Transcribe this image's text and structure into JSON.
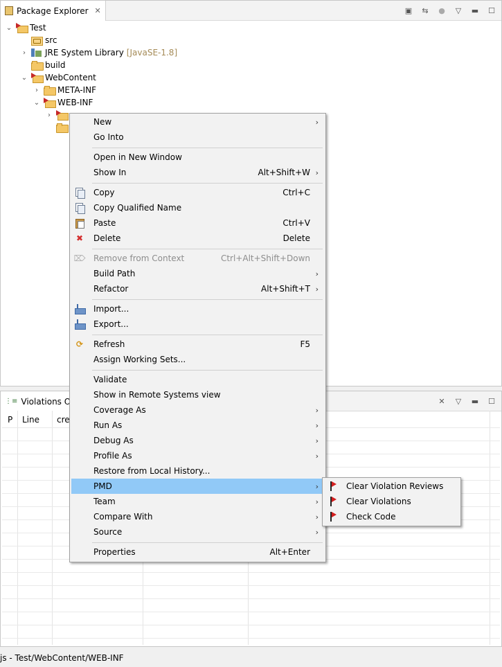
{
  "package_explorer": {
    "tab_title": "Package Explorer",
    "tree": [
      {
        "label": "Test",
        "decoration": ""
      },
      {
        "label": "src",
        "decoration": ""
      },
      {
        "label": "JRE System Library",
        "decoration": "[JavaSE-1.8]"
      },
      {
        "label": "build",
        "decoration": ""
      },
      {
        "label": "WebContent",
        "decoration": ""
      },
      {
        "label": "META-INF",
        "decoration": ""
      },
      {
        "label": "WEB-INF",
        "decoration": ""
      }
    ]
  },
  "violations_outline": {
    "tab_title": "Violations Out",
    "columns": [
      "P",
      "Line",
      "crea"
    ]
  },
  "context_menu": {
    "items": [
      {
        "label": "New",
        "shortcut": "",
        "submenu": true
      },
      {
        "label": "Go Into",
        "shortcut": ""
      },
      {
        "label": "Open in New Window",
        "shortcut": ""
      },
      {
        "label": "Show In",
        "shortcut": "Alt+Shift+W",
        "submenu": true
      },
      {
        "label": "Copy",
        "shortcut": "Ctrl+C",
        "icon": "copy-icon"
      },
      {
        "label": "Copy Qualified Name",
        "shortcut": "",
        "icon": "copy-qualified-name-icon"
      },
      {
        "label": "Paste",
        "shortcut": "Ctrl+V",
        "icon": "paste-icon"
      },
      {
        "label": "Delete",
        "shortcut": "Delete",
        "icon": "delete-icon"
      },
      {
        "label": "Remove from Context",
        "shortcut": "Ctrl+Alt+Shift+Down",
        "disabled": true,
        "icon": "remove-context-icon"
      },
      {
        "label": "Build Path",
        "shortcut": "",
        "submenu": true
      },
      {
        "label": "Refactor",
        "shortcut": "Alt+Shift+T",
        "submenu": true
      },
      {
        "label": "Import...",
        "shortcut": "",
        "icon": "import-icon"
      },
      {
        "label": "Export...",
        "shortcut": "",
        "icon": "export-icon"
      },
      {
        "label": "Refresh",
        "shortcut": "F5",
        "icon": "refresh-icon"
      },
      {
        "label": "Assign Working Sets...",
        "shortcut": ""
      },
      {
        "label": "Validate",
        "shortcut": ""
      },
      {
        "label": "Show in Remote Systems view",
        "shortcut": ""
      },
      {
        "label": "Coverage As",
        "shortcut": "",
        "submenu": true
      },
      {
        "label": "Run As",
        "shortcut": "",
        "submenu": true
      },
      {
        "label": "Debug As",
        "shortcut": "",
        "submenu": true
      },
      {
        "label": "Profile As",
        "shortcut": "",
        "submenu": true
      },
      {
        "label": "Restore from Local History...",
        "shortcut": ""
      },
      {
        "label": "PMD",
        "shortcut": "",
        "submenu": true,
        "highlighted": true
      },
      {
        "label": "Team",
        "shortcut": "",
        "submenu": true
      },
      {
        "label": "Compare With",
        "shortcut": "",
        "submenu": true
      },
      {
        "label": "Source",
        "shortcut": "",
        "submenu": true
      },
      {
        "label": "Properties",
        "shortcut": "Alt+Enter"
      }
    ]
  },
  "pmd_submenu": {
    "items": [
      {
        "label": "Clear Violation Reviews"
      },
      {
        "label": "Clear Violations"
      },
      {
        "label": "Check Code"
      }
    ]
  },
  "status_bar": {
    "text": "js - Test/WebContent/WEB-INF"
  },
  "colors": {
    "menu_highlight": "#91c9f7",
    "menu_background": "#f2f2f2"
  }
}
